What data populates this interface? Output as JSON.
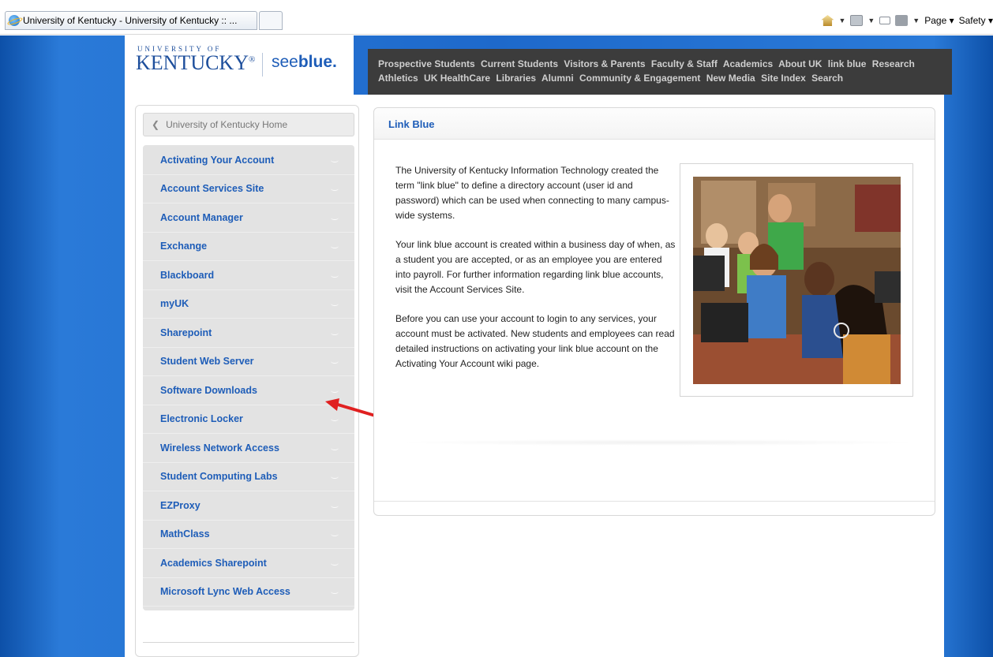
{
  "browser": {
    "tab_title": "University of Kentucky - University of Kentucky :: ...",
    "commands": {
      "page_label": "Page",
      "safety_label": "Safety"
    }
  },
  "header": {
    "logo_small": "UNIVERSITY OF",
    "logo_big": "KENTUCKY",
    "logo_mark": "®",
    "tagline_see": "see",
    "tagline_blue": "blue.",
    "nav": [
      "Prospective Students",
      "Current Students",
      "Visitors & Parents",
      "Faculty & Staff",
      "Academics",
      "About UK",
      "link blue",
      "Research",
      "Athletics",
      "UK HealthCare",
      "Libraries",
      "Alumni",
      "Community & Engagement",
      "New Media",
      "Site Index",
      "Search"
    ]
  },
  "sidebar": {
    "home_label": "University of Kentucky Home",
    "items": [
      "Activating Your Account",
      "Account Services Site",
      "Account Manager",
      "Exchange",
      "Blackboard",
      "myUK",
      "Sharepoint",
      "Student Web Server",
      "Software Downloads",
      "Electronic Locker",
      "Wireless Network Access",
      "Student Computing Labs",
      "EZProxy",
      "MathClass",
      "Academics Sharepoint",
      "Microsoft Lync Web Access"
    ]
  },
  "content": {
    "title": "Link Blue",
    "paragraphs": [
      "The University of Kentucky Information Technology created the term \"link blue\" to define a directory account (user id and password) which can be used when connecting to many campus-wide systems.",
      "Your link blue account is created within a business day of when, as a student you are accepted, or as an employee you are entered into payroll. For further information regarding link blue accounts, visit the Account Services Site.",
      "Before you can use your account to login to any services, your account must be activated. New students and employees can read detailed instructions on activating your link blue account on the Activating Your Account wiki page."
    ]
  },
  "colors": {
    "brand_blue": "#1e5db8",
    "nav_bg": "#3c3c3c",
    "annotation_red": "#e02020"
  }
}
